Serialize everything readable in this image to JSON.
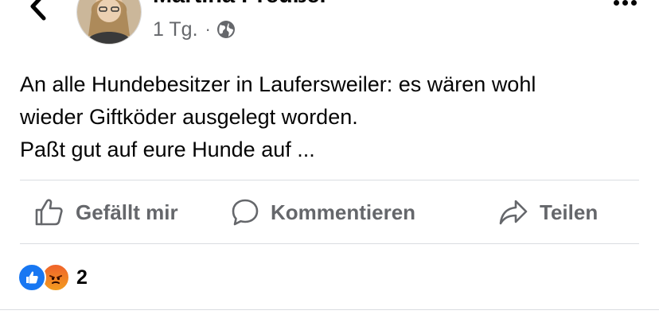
{
  "header": {
    "author": "Martina Preußer",
    "time": "1 Tg.",
    "separator": "·",
    "audience_icon": "globe-icon",
    "back_icon": "chevron-left-icon",
    "more_icon": "more-horizontal-icon"
  },
  "post": {
    "lines": [
      "An alle Hundebesitzer in Laufersweiler: es wären wohl",
      "wieder Giftköder ausgelegt worden.",
      "Paßt gut auf eure Hunde auf ..."
    ]
  },
  "actions": {
    "like": {
      "label": "Gefällt mir",
      "icon": "thumbs-up-icon"
    },
    "comment": {
      "label": "Kommentieren",
      "icon": "comment-icon"
    },
    "share": {
      "label": "Teilen",
      "icon": "share-icon"
    }
  },
  "reactions": {
    "types": [
      "like",
      "angry"
    ],
    "count": "2"
  },
  "colors": {
    "secondary_text": "#65676b",
    "divider": "#dadde1",
    "like_blue": "#1877f2",
    "angry_orange": "#f0632b"
  }
}
